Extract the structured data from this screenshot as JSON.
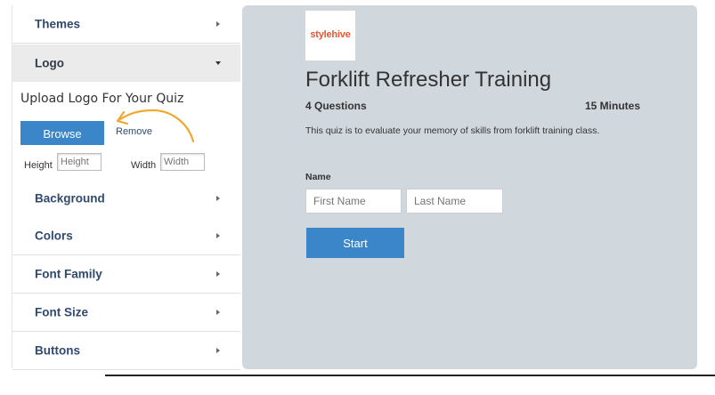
{
  "sidebar": {
    "items": [
      {
        "label": "Themes",
        "icon": "chevron-right-icon"
      },
      {
        "label": "Logo",
        "icon": "chevron-down-icon"
      },
      {
        "label": "Background",
        "icon": "chevron-right-icon"
      },
      {
        "label": "Colors",
        "icon": "chevron-right-icon"
      },
      {
        "label": "Font Family",
        "icon": "chevron-right-icon"
      },
      {
        "label": "Font Size",
        "icon": "chevron-right-icon"
      },
      {
        "label": "Buttons",
        "icon": "chevron-right-icon"
      }
    ],
    "logo_panel": {
      "title": "Upload Logo For Your Quiz",
      "browse_label": "Browse",
      "remove_label": "Remove",
      "height_label": "Height",
      "height_placeholder": "Height",
      "width_label": "Width",
      "width_placeholder": "Width"
    }
  },
  "preview": {
    "logo_text": "stylehive",
    "title": "Forklift Refresher Training",
    "questions": "4 Questions",
    "duration": "15 Minutes",
    "description": "This quiz is to evaluate your memory of skills from forklift training class.",
    "name_label": "Name",
    "first_name_placeholder": "First Name",
    "last_name_placeholder": "Last Name",
    "start_label": "Start"
  },
  "colors": {
    "accent": "#3a86c8",
    "preview_bg": "#d0d8de",
    "nav_text": "#2f4a6e",
    "annotation_arrow": "#f0a830"
  }
}
